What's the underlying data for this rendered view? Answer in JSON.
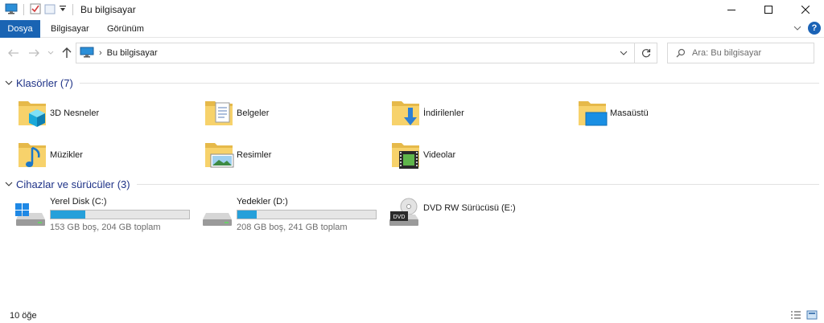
{
  "window": {
    "title": "Bu bilgisayar"
  },
  "ribbon": {
    "tabs": [
      "Dosya",
      "Bilgisayar",
      "Görünüm"
    ],
    "help_label": "?"
  },
  "address": {
    "path": "Bu bilgisayar",
    "search_placeholder": "Ara: Bu bilgisayar"
  },
  "folders_section": {
    "title": "Klasörler (7)",
    "items": [
      {
        "label": "3D Nesneler",
        "icon": "3d-objects-folder-icon"
      },
      {
        "label": "Belgeler",
        "icon": "documents-folder-icon"
      },
      {
        "label": "İndirilenler",
        "icon": "downloads-folder-icon"
      },
      {
        "label": "Masaüstü",
        "icon": "desktop-folder-icon"
      },
      {
        "label": "Müzikler",
        "icon": "music-folder-icon"
      },
      {
        "label": "Resimler",
        "icon": "pictures-folder-icon"
      },
      {
        "label": "Videolar",
        "icon": "videos-folder-icon"
      }
    ]
  },
  "drives_section": {
    "title": "Cihazlar ve sürücüler (3)",
    "drives": [
      {
        "name": "Yerel Disk (C:)",
        "sub": "153 GB boş, 204 GB toplam",
        "used_fraction": 0.25,
        "icon": "windows-drive-icon"
      },
      {
        "name": "Yedekler (D:)",
        "sub": "208 GB boş, 241 GB toplam",
        "used_fraction": 0.14,
        "icon": "hard-drive-icon"
      },
      {
        "name": "DVD RW Sürücüsü (E:)",
        "icon": "dvd-drive-icon",
        "badge": "DVD"
      }
    ]
  },
  "status": {
    "count": "10 öğe"
  },
  "colors": {
    "accent": "#1a64b3",
    "section_title": "#1e3287",
    "bar_fill": "#26a0da"
  }
}
